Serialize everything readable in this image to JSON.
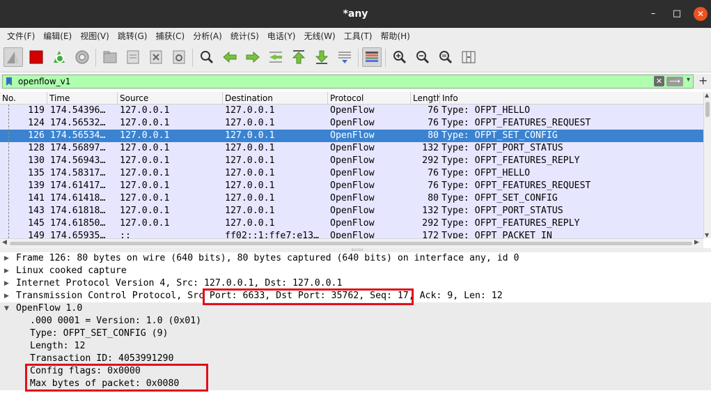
{
  "window": {
    "title": "*any",
    "minimize": "–",
    "maximize": "□",
    "close": "✕"
  },
  "menu": [
    "文件(F)",
    "编辑(E)",
    "视图(V)",
    "跳转(G)",
    "捕获(C)",
    "分析(A)",
    "统计(S)",
    "电话(Y)",
    "无线(W)",
    "工具(T)",
    "帮助(H)"
  ],
  "filter": {
    "value": "openflow_v1",
    "clear": "✕",
    "apply": "⟶",
    "dropdown": "▾",
    "add": "+"
  },
  "columns": [
    "No.",
    "Time",
    "Source",
    "Destination",
    "Protocol",
    "Length",
    "Info"
  ],
  "packets": [
    {
      "no": "119",
      "time": "174.54396…",
      "src": "127.0.0.1",
      "dst": "127.0.0.1",
      "proto": "OpenFlow",
      "len": "76",
      "info": "Type: OFPT_HELLO"
    },
    {
      "no": "124",
      "time": "174.56532…",
      "src": "127.0.0.1",
      "dst": "127.0.0.1",
      "proto": "OpenFlow",
      "len": "76",
      "info": "Type: OFPT_FEATURES_REQUEST"
    },
    {
      "no": "126",
      "time": "174.56534…",
      "src": "127.0.0.1",
      "dst": "127.0.0.1",
      "proto": "OpenFlow",
      "len": "80",
      "info": "Type: OFPT_SET_CONFIG"
    },
    {
      "no": "128",
      "time": "174.56897…",
      "src": "127.0.0.1",
      "dst": "127.0.0.1",
      "proto": "OpenFlow",
      "len": "132",
      "info": "Type: OFPT_PORT_STATUS"
    },
    {
      "no": "130",
      "time": "174.56943…",
      "src": "127.0.0.1",
      "dst": "127.0.0.1",
      "proto": "OpenFlow",
      "len": "292",
      "info": "Type: OFPT_FEATURES_REPLY"
    },
    {
      "no": "135",
      "time": "174.58317…",
      "src": "127.0.0.1",
      "dst": "127.0.0.1",
      "proto": "OpenFlow",
      "len": "76",
      "info": "Type: OFPT_HELLO"
    },
    {
      "no": "139",
      "time": "174.61417…",
      "src": "127.0.0.1",
      "dst": "127.0.0.1",
      "proto": "OpenFlow",
      "len": "76",
      "info": "Type: OFPT_FEATURES_REQUEST"
    },
    {
      "no": "141",
      "time": "174.61418…",
      "src": "127.0.0.1",
      "dst": "127.0.0.1",
      "proto": "OpenFlow",
      "len": "80",
      "info": "Type: OFPT_SET_CONFIG"
    },
    {
      "no": "143",
      "time": "174.61818…",
      "src": "127.0.0.1",
      "dst": "127.0.0.1",
      "proto": "OpenFlow",
      "len": "132",
      "info": "Type: OFPT_PORT_STATUS"
    },
    {
      "no": "145",
      "time": "174.61850…",
      "src": "127.0.0.1",
      "dst": "127.0.0.1",
      "proto": "OpenFlow",
      "len": "292",
      "info": "Type: OFPT_FEATURES_REPLY"
    },
    {
      "no": "149",
      "time": "174.65935…",
      "src": "::",
      "dst": "ff02::1:ffe7:e13…",
      "proto": "OpenFlow",
      "len": "172",
      "info": "Type: OFPT_PACKET_IN"
    }
  ],
  "details": {
    "frame": "Frame 126: 80 bytes on wire (640 bits), 80 bytes captured (640 bits) on interface any, id 0",
    "linux": "Linux cooked capture",
    "ip": "Internet Protocol Version 4, Src: 127.0.0.1, Dst: 127.0.0.1",
    "tcp": "Transmission Control Protocol, Src Port: 6633, Dst Port: 35762, Seq: 17, Ack: 9, Len: 12",
    "openflow": "OpenFlow 1.0",
    "children": [
      ".000 0001 = Version: 1.0 (0x01)",
      "Type: OFPT_SET_CONFIG (9)",
      "Length: 12",
      "Transaction ID: 4053991290",
      "Config flags: 0x0000",
      "Max bytes of packet: 0x0080"
    ]
  },
  "colors": {
    "accent_close": "#e95420",
    "selected_row": "#3b83d0",
    "row_bg": "#e7e6ff",
    "filter_valid": "#afffaf",
    "highlight_box": "#e0101a"
  }
}
